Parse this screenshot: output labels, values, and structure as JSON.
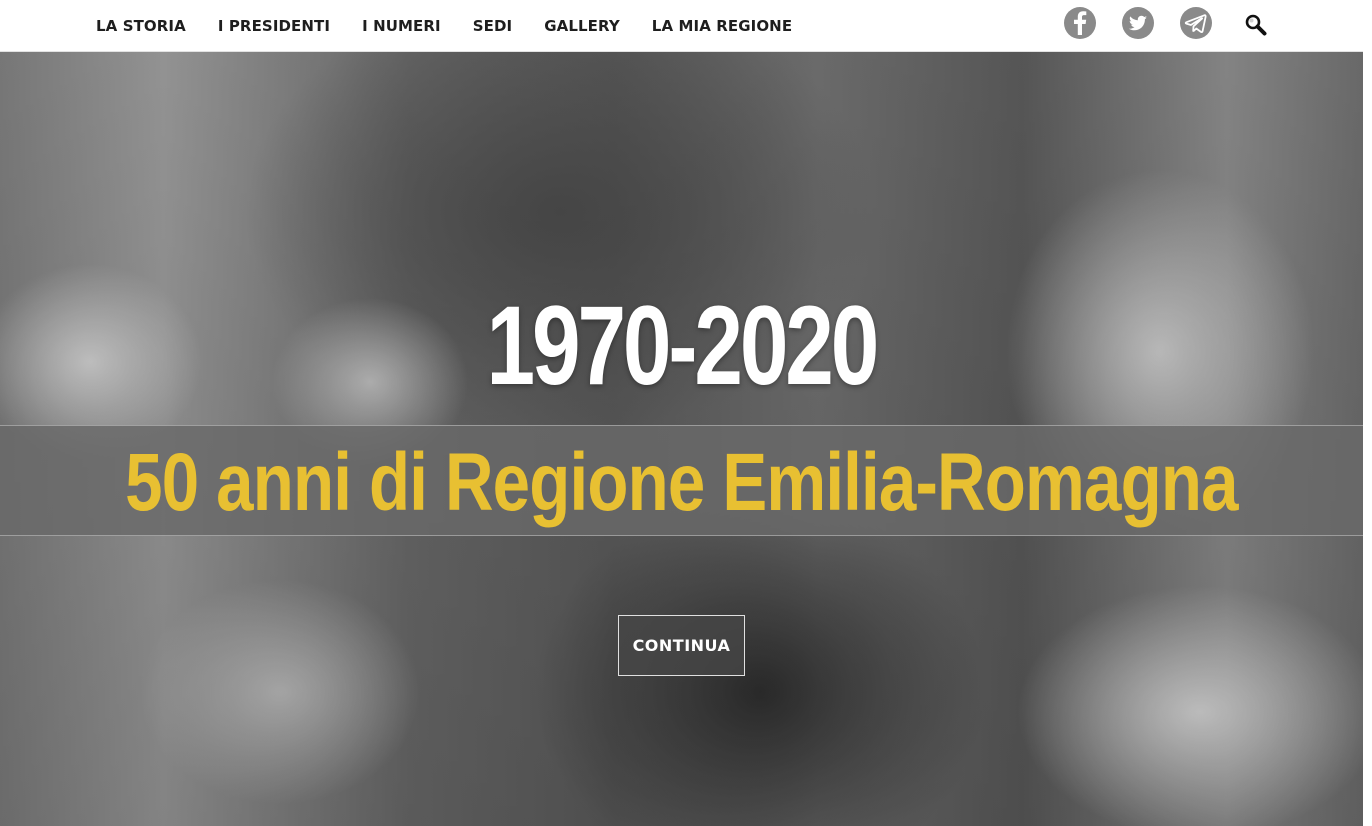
{
  "nav": {
    "items": [
      {
        "label": "LA STORIA"
      },
      {
        "label": "I PRESIDENTI"
      },
      {
        "label": "I NUMERI"
      },
      {
        "label": "SEDI"
      },
      {
        "label": "GALLERY"
      },
      {
        "label": "LA MIA REGIONE"
      }
    ]
  },
  "social": {
    "icons": [
      "facebook-icon",
      "twitter-icon",
      "telegram-icon",
      "search-icon"
    ],
    "icon_color": "#8a8a8a"
  },
  "hero": {
    "years": "1970-2020",
    "subtitle": "50 anni di Regione Emilia-Romagna",
    "continue_label": "CONTINUA",
    "subtitle_color": "#e8c032"
  }
}
